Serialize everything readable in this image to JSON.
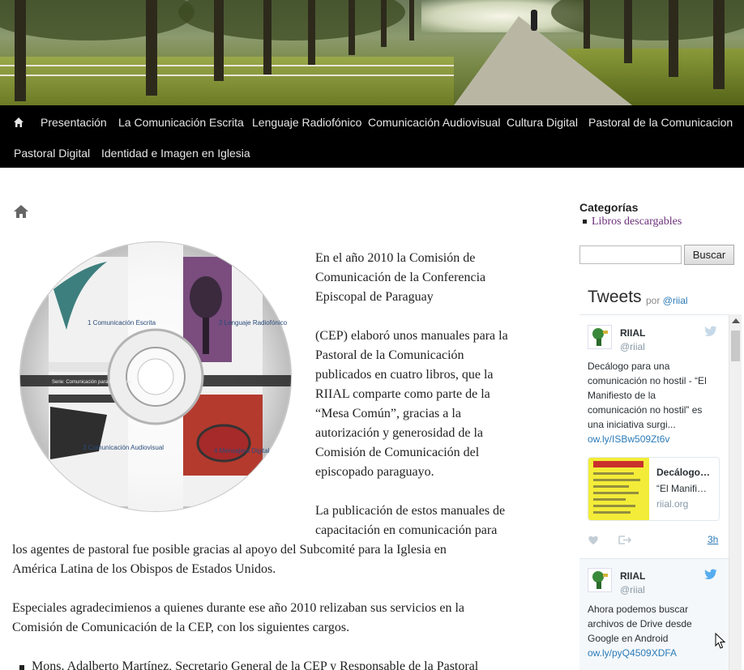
{
  "nav": {
    "items": [
      "Presentación",
      "La Comunicación Escrita",
      "Lenguaje Radiofónico",
      "Comunicación Audiovisual",
      "Cultura Digital",
      "Pastoral de la Comunicacion",
      "Pastoral Digital",
      "Identidad e Imagen en Iglesia"
    ]
  },
  "article": {
    "p1": [
      "En el año 2010 la Comisión de",
      "Comunicación de la Conferencia",
      "Episcopal de Paraguay"
    ],
    "p2": [
      "(CEP) elaboró unos manuales para la",
      "Pastoral de la Comunicación",
      "publicados en cuatro libros, que la",
      "RIIAL comparte como parte de la",
      "“Mesa Común”, gracias a la",
      "autorización y generosidad de la",
      "Comisión de Comunicación del",
      "episcopado paraguayo."
    ],
    "p3": [
      "La publicación de estos manuales de",
      "capacitación en comunicación para",
      "los agentes de pastoral fue posible gracias al apoyo del Subcomité para la Iglesia en",
      "América Latina de los Obispos de Estados Unidos."
    ],
    "p4": [
      "Especiales agradecimienos a quienes durante ese año  2010 relizaban sus servicios en la",
      "Comisión de Comunicación de la CEP, con los siguientes cargos."
    ],
    "list_item": "Mons. Adalberto Martínez, Secretario General de la CEP y Responsable de la Pastoral",
    "cd": {
      "q1": "1 Comunicación Escrita",
      "q2": "2 Lenguaje Radiofónico",
      "q3": "3 Comunicación Audiovisual",
      "q4": "4 Mensajero Digital",
      "series": "Serie: Comunicación para la pastoral"
    }
  },
  "sidebar": {
    "categories_title": "Categorías",
    "category_link": "Libros descargables",
    "search_button": "Buscar",
    "search_value": "",
    "tweets_title": "Tweets",
    "tweets_by": "por",
    "tweets_handle": "@riial",
    "tweets": [
      {
        "name": "RIIAL",
        "handle": "@riial",
        "text": [
          "Decálogo para una",
          "comunicación no hostil - “El",
          "Manifiesto de la",
          "comunicación no hostil” es",
          "una iniciativa surgi..."
        ],
        "link": "ow.ly/ISBw509Zt6v",
        "card": {
          "title": "Decálogo…",
          "desc": "“El Manifi…",
          "domain": "riial.org"
        },
        "time": "3h"
      },
      {
        "name": "RIIAL",
        "handle": "@riial",
        "text": [
          "Ahora podemos buscar",
          "archivos de Drive desde",
          "Google en Android"
        ],
        "link": "ow.ly/pyQ4509XDFA"
      }
    ]
  },
  "colors": {
    "nav_bg": "#000000",
    "link_purple": "#6b2f7a",
    "twitter_blue": "#2b7bb9"
  }
}
